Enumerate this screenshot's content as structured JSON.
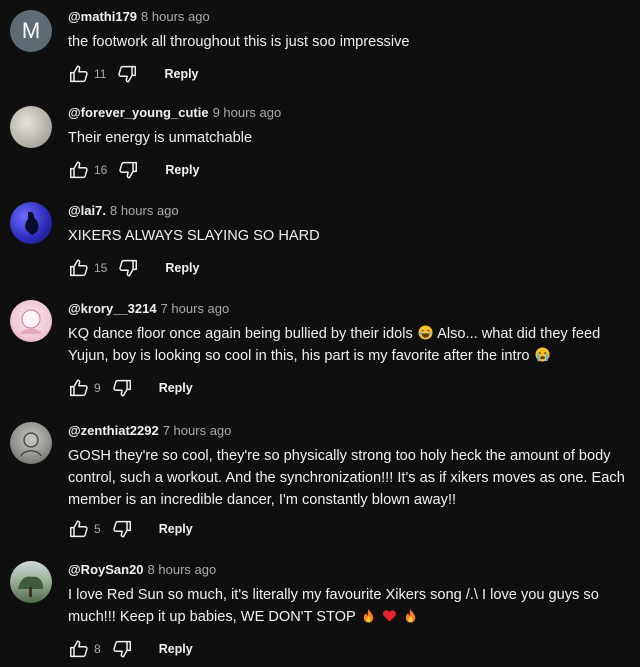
{
  "comments": [
    {
      "handle": "@mathi179",
      "time": "8 hours ago",
      "avatar_letter": "M",
      "avatar_color": "#5f6b73",
      "text": "the footwork all throughout this is just soo impressive",
      "likes": "11",
      "reply_label": "Reply"
    },
    {
      "handle": "@forever_young_cutie",
      "time": "9 hours ago",
      "avatar_color": "#bdb9b3",
      "text": "Their energy is unmatchable",
      "likes": "16",
      "reply_label": "Reply"
    },
    {
      "handle": "@lai7.",
      "time": "8 hours ago",
      "avatar_color": "#3b3bd0",
      "text": "XIKERS ALWAYS SLAYING SO HARD",
      "likes": "15",
      "reply_label": "Reply"
    },
    {
      "handle": "@krory__3214",
      "time": "7 hours ago",
      "avatar_color": "#f3d7df",
      "text_part1": "KQ dance floor once again being bullied by their idols",
      "text_part2": " Also... what did they feed Yujun, boy is looking so cool in this, his part is my favorite after the intro",
      "likes": "9",
      "reply_label": "Reply"
    },
    {
      "handle": "@zenthiat2292",
      "time": "7 hours ago",
      "avatar_color": "#8d8d8a",
      "text": "GOSH they're so cool, they're so physically strong too holy heck the amount of body control, such a workout. And the synchronization!!! It's as if xikers moves as one. Each member is an incredible dancer, I'm constantly blown away!!",
      "likes": "5",
      "reply_label": "Reply"
    },
    {
      "handle": "@RoySan20",
      "time": "8 hours ago",
      "avatar_color": "#6f8a6a",
      "text": "I love Red Sun so much, it's literally my favourite Xikers song /.\\ I love you guys so much!!! Keep it up babies, WE DON'T STOP",
      "likes": "8",
      "reply_label": "Reply"
    }
  ],
  "icons": {
    "like": "thumbs-up-icon",
    "dislike": "thumbs-down-icon",
    "emoji_laugh": "laughing-emoji-icon",
    "emoji_cry": "crying-emoji-icon",
    "emoji_fire": "fire-emoji-icon",
    "emoji_heart": "red-heart-emoji-icon"
  },
  "colors": {
    "background": "#0f0f0f",
    "primary_text": "#f1f1f1",
    "secondary_text": "#aaaaaa"
  }
}
